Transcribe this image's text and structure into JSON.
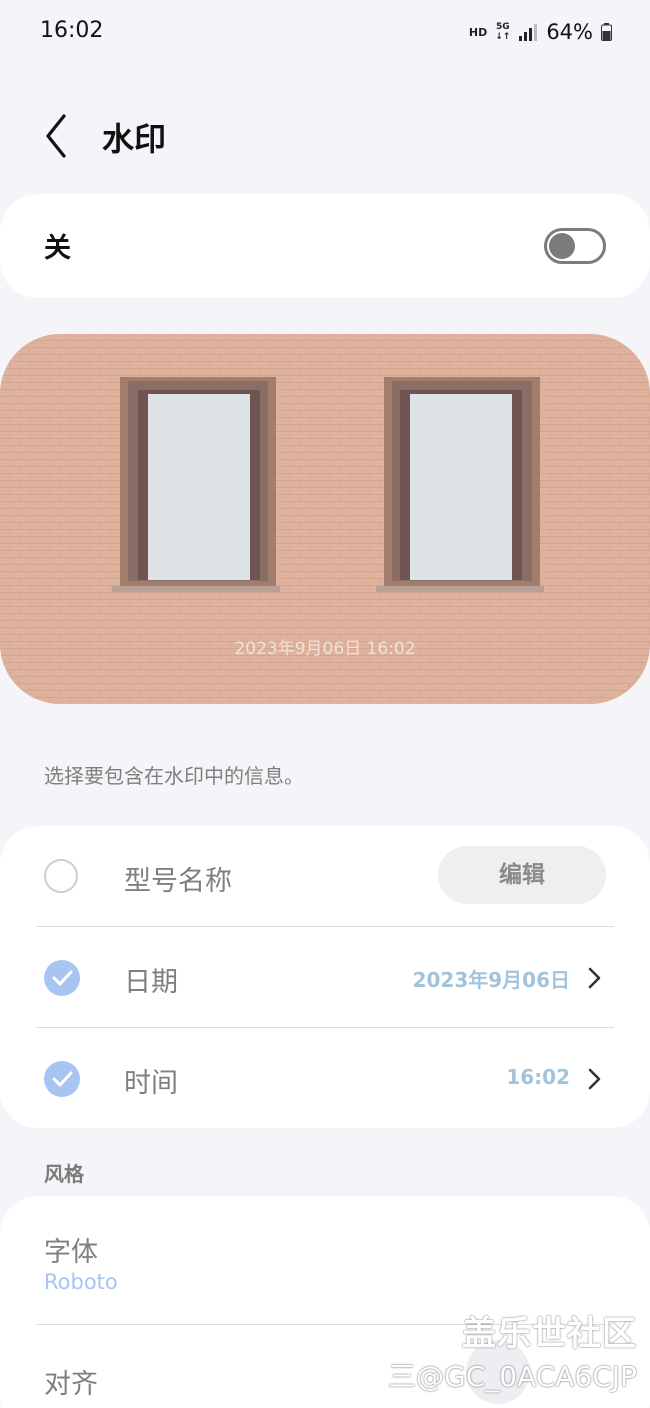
{
  "status_bar": {
    "time": "16:02",
    "hd": "HD",
    "network": "5G",
    "battery_percent": "64%"
  },
  "header": {
    "title": "水印"
  },
  "toggle": {
    "label": "关",
    "enabled": false
  },
  "preview": {
    "watermark_text": "2023年9月06日 16:02"
  },
  "hint_text": "选择要包含在水印中的信息。",
  "options": {
    "model_name": {
      "label": "型号名称",
      "checked": false,
      "edit_label": "编辑"
    },
    "date": {
      "label": "日期",
      "checked": true,
      "value": "2023年9月06日"
    },
    "time": {
      "label": "时间",
      "checked": true,
      "value": "16:02"
    }
  },
  "style_section": {
    "title": "风格",
    "font_label": "字体",
    "font_value": "Roboto",
    "align_label": "对齐"
  },
  "overlay": {
    "brand": "盖乐世社区",
    "user_id": "三@GC_0ACA6CJP"
  },
  "colors": {
    "accent": "#a8c4f3",
    "value_text": "#a2c3dc",
    "background": "#f5f5f9",
    "brick": "#d9a58c"
  }
}
